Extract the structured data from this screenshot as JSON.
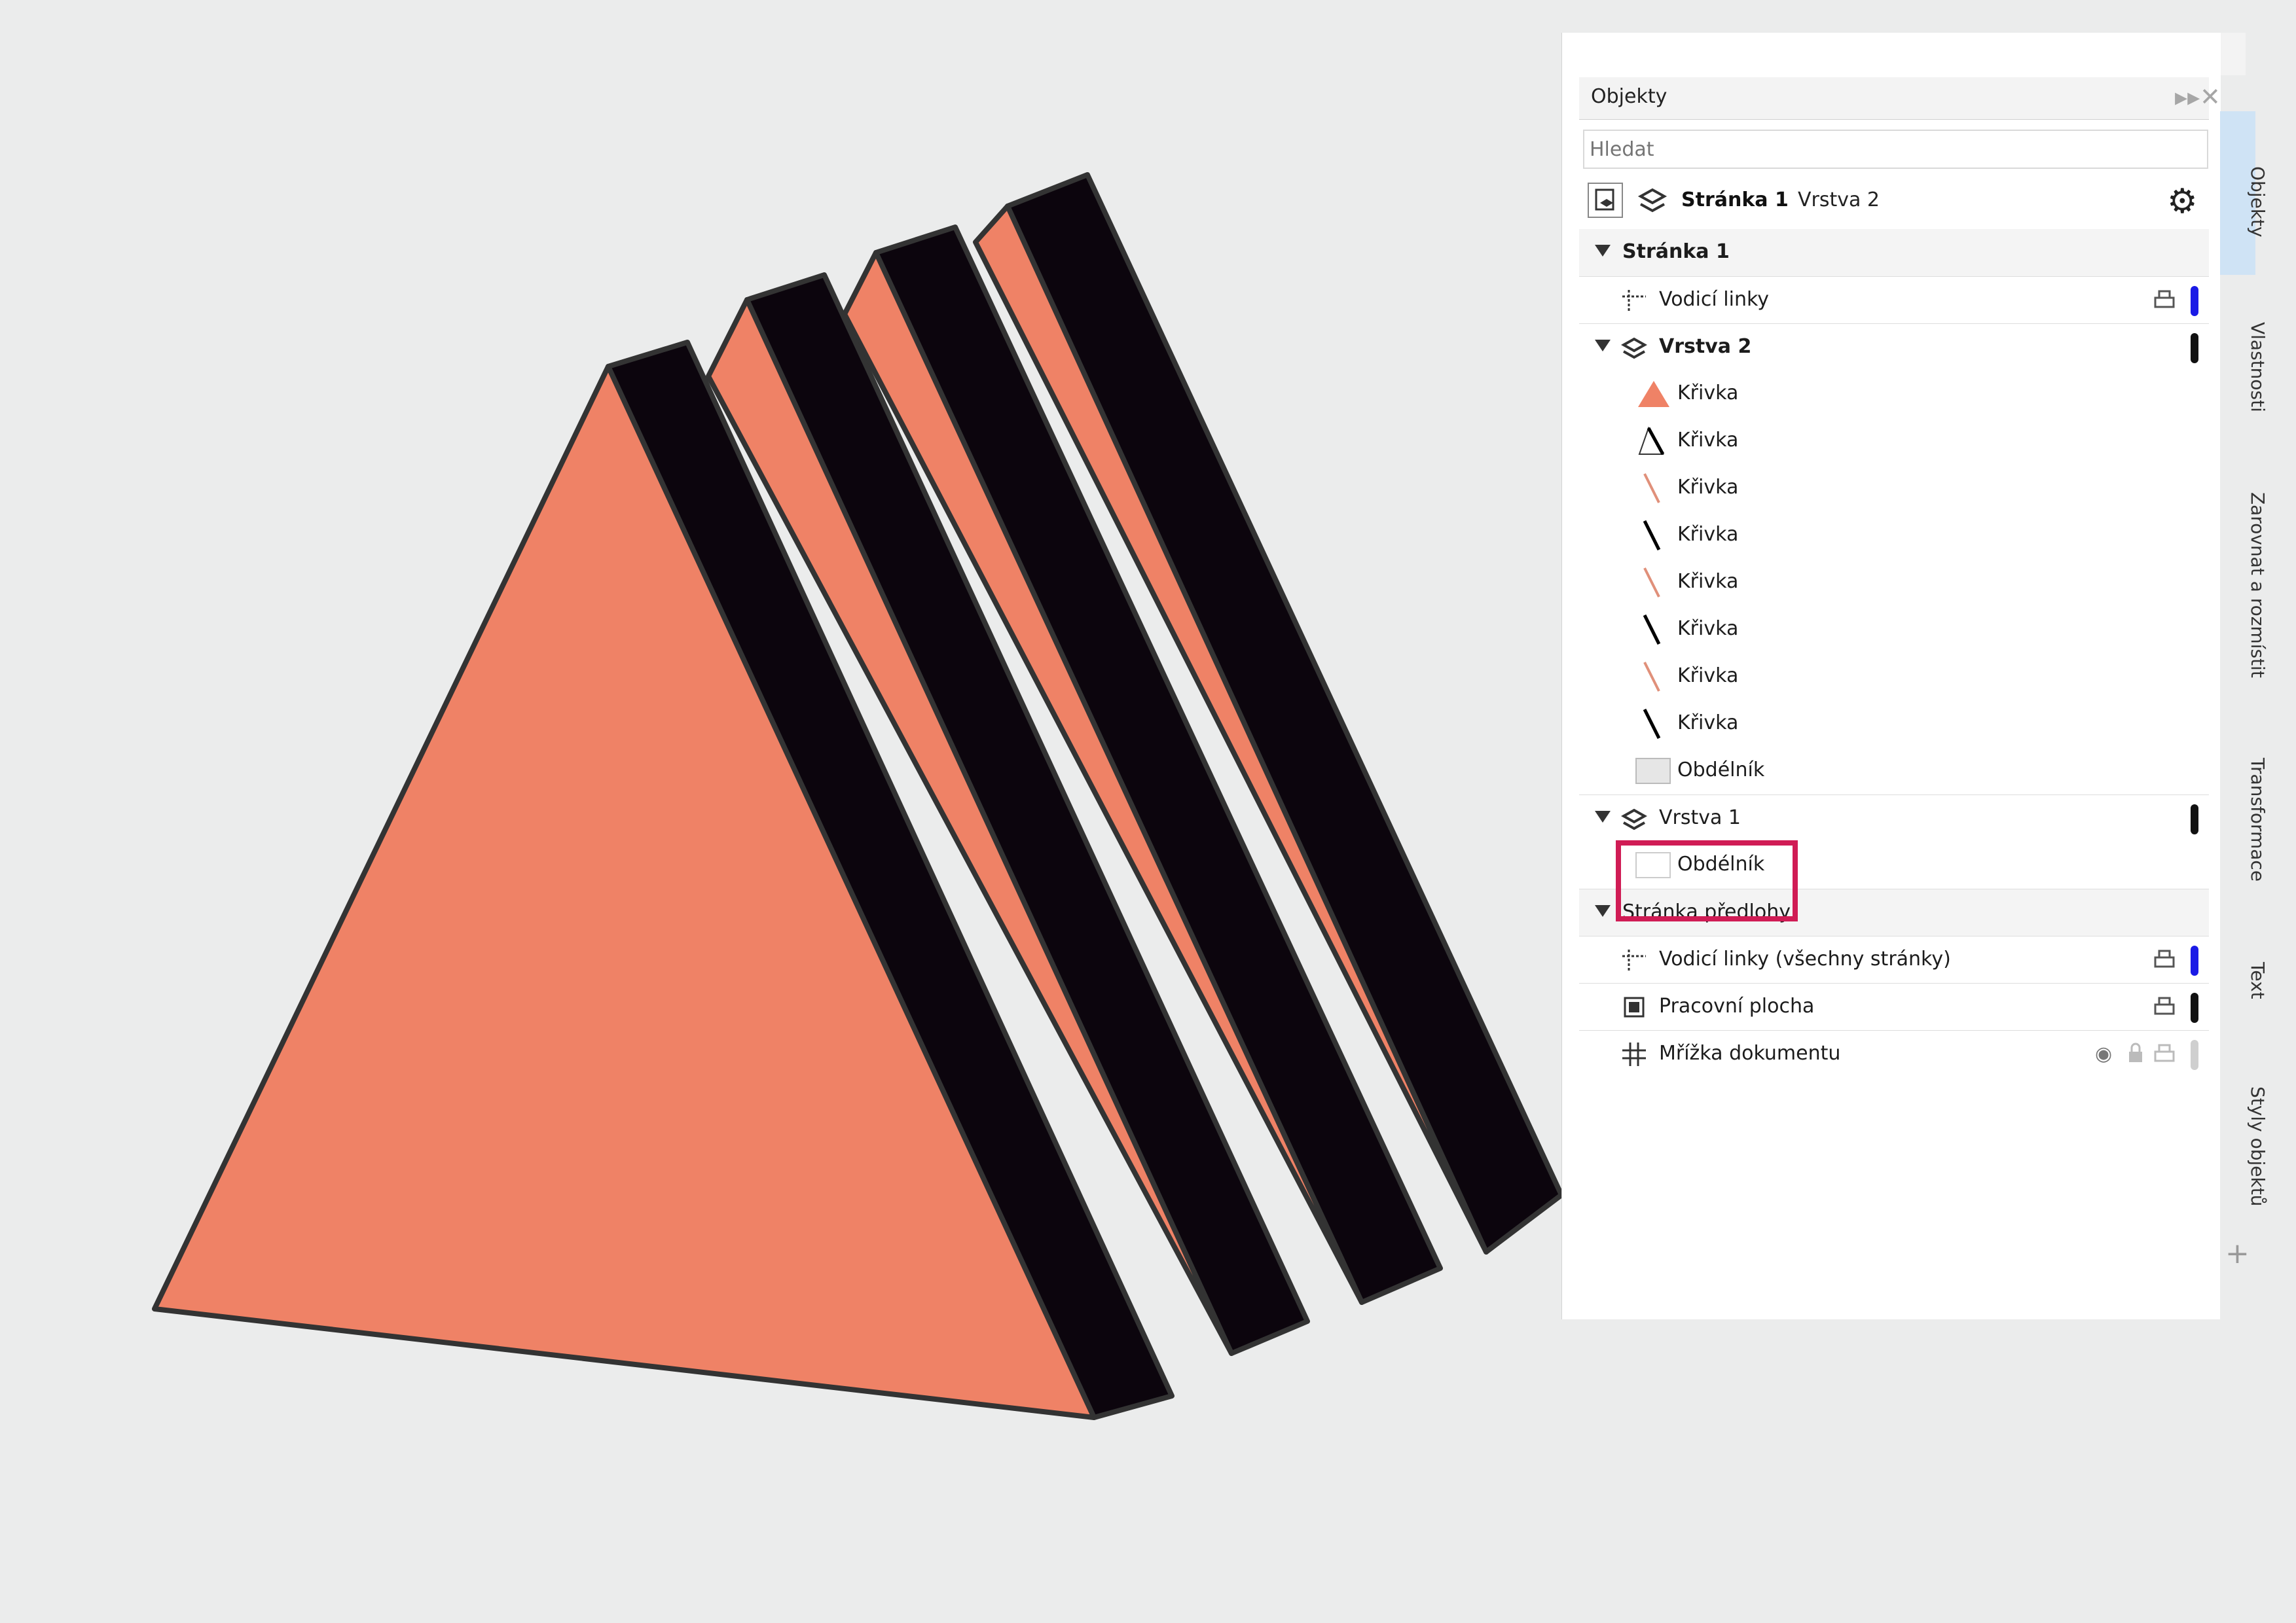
{
  "panel": {
    "title": "Objekty",
    "search": {
      "placeholder": "Hledat",
      "value": ""
    },
    "toolbar": {
      "current_page": "Stránka 1",
      "current_layer": "Vrstva 2"
    },
    "tree": {
      "page1": {
        "label": "Stránka 1",
        "guides": "Vodicí linky",
        "layer2": {
          "label": "Vrstva 2",
          "items": [
            "Křivka",
            "Křivka",
            "Křivka",
            "Křivka",
            "Křivka",
            "Křivka",
            "Křivka",
            "Křivka",
            "Obdélník"
          ]
        },
        "layer1": {
          "label": "Vrstva 1",
          "items": [
            "Obdélník"
          ]
        }
      },
      "master": {
        "label": "Stránka předlohy",
        "guides": "Vodicí linky (všechny stránky)",
        "desktop": "Pracovní plocha",
        "grid": "Mřížka dokumentu"
      }
    }
  },
  "side_tabs": [
    "Objekty",
    "Vlastnosti",
    "Zarovnat a rozmístit",
    "Transformace",
    "Text",
    "Styly objektů"
  ],
  "colors": {
    "salmon": "#ef8266",
    "black_face": "#0c050d",
    "outline": "#333333",
    "highlight": "#d01c55",
    "blue_bar": "#1a1ae6",
    "canvas_bg": "#ebecec"
  }
}
